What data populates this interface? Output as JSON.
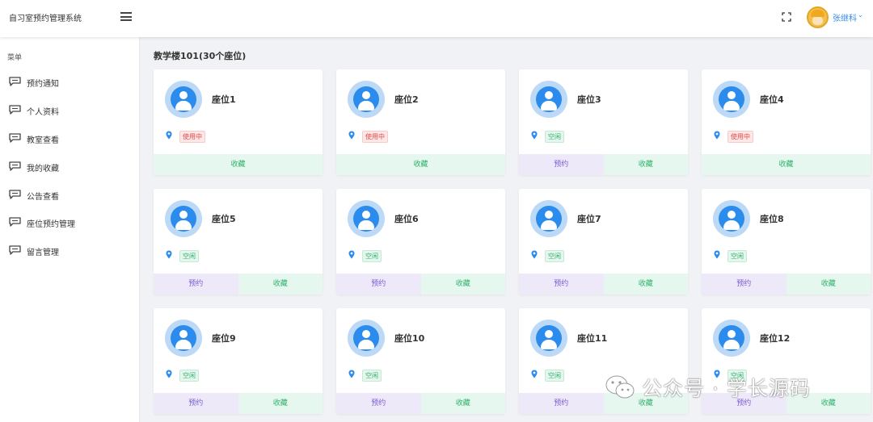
{
  "header": {
    "app_title": "自习室预约管理系统",
    "user_name": "张继科",
    "menu_toggle_icon": "hamburger-icon",
    "fullscreen_icon": "fullscreen-icon"
  },
  "sidebar": {
    "menu_title": "菜单",
    "items": [
      {
        "label": "预约通知",
        "icon": "comment-icon"
      },
      {
        "label": "个人资料",
        "icon": "comment-icon"
      },
      {
        "label": "教室查看",
        "icon": "comment-icon"
      },
      {
        "label": "我的收藏",
        "icon": "comment-icon"
      },
      {
        "label": "公告查看",
        "icon": "comment-icon"
      },
      {
        "label": "座位预约管理",
        "icon": "comment-icon"
      },
      {
        "label": "留言管理",
        "icon": "comment-icon"
      }
    ]
  },
  "main": {
    "section_title": "教学楼101(30个座位)",
    "seats": [
      {
        "name": "座位1",
        "status": "使用中",
        "status_type": "busy"
      },
      {
        "name": "座位2",
        "status": "使用中",
        "status_type": "busy"
      },
      {
        "name": "座位3",
        "status": "空闲",
        "status_type": "free"
      },
      {
        "name": "座位4",
        "status": "使用中",
        "status_type": "busy"
      },
      {
        "name": "座位5",
        "status": "空闲",
        "status_type": "free"
      },
      {
        "name": "座位6",
        "status": "空闲",
        "status_type": "free"
      },
      {
        "name": "座位7",
        "status": "空闲",
        "status_type": "free"
      },
      {
        "name": "座位8",
        "status": "空闲",
        "status_type": "free"
      },
      {
        "name": "座位9",
        "status": "空闲",
        "status_type": "free"
      },
      {
        "name": "座位10",
        "status": "空闲",
        "status_type": "free"
      },
      {
        "name": "座位11",
        "status": "空闲",
        "status_type": "free"
      },
      {
        "name": "座位12",
        "status": "空闲",
        "status_type": "free"
      }
    ],
    "book_label": "预约",
    "fav_label": "收藏"
  },
  "watermark": {
    "text": "公众号 · 学长源码"
  },
  "colors": {
    "accent": "#2b8ced",
    "busy": "#e04a4a",
    "free": "#2fb26b",
    "book": "#7b5bd1"
  }
}
